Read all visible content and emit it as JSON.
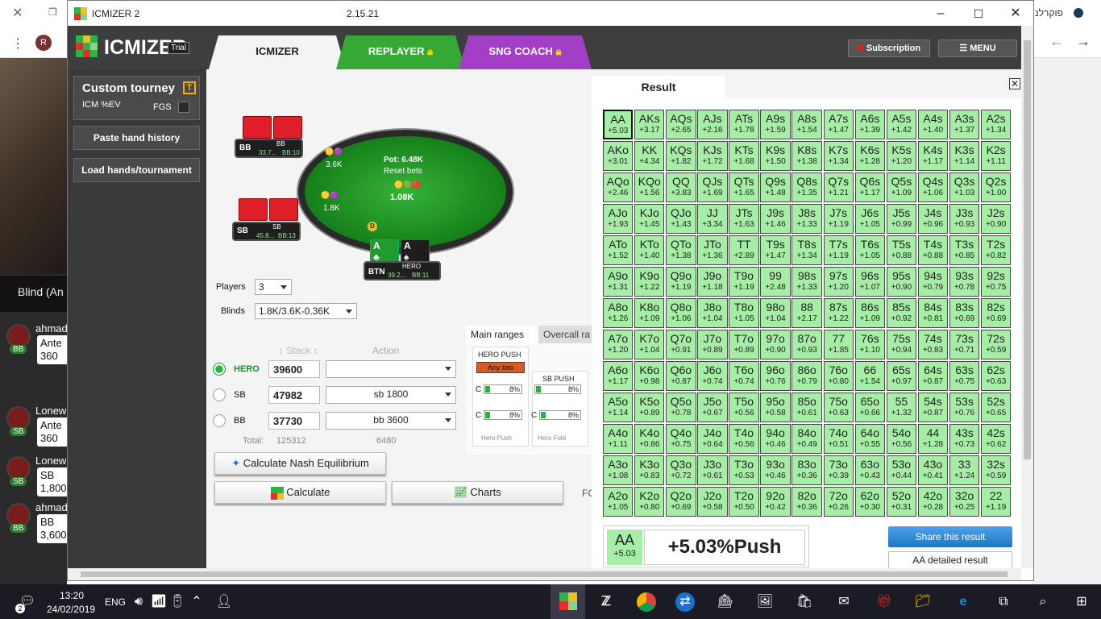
{
  "app": {
    "title": "ICMIZER 2",
    "version": "2.15.21",
    "logo_text": "ICMIZER",
    "trial_badge": "Trial"
  },
  "background": {
    "hebrew_text": "פוקרלנ",
    "blind_label": "Blind (An",
    "seats": [
      {
        "name": "ahmad",
        "pos": "BB",
        "line1": "Ante",
        "line2": "360"
      },
      {
        "name": "Lonew",
        "pos": "SB",
        "line1": "Ante",
        "line2": "360"
      },
      {
        "name": "Lonew",
        "pos": "SB",
        "line1": "SB",
        "line2": "1,800"
      },
      {
        "name": "ahmad",
        "pos": "BB",
        "line1": "BB",
        "line2": "3,600"
      }
    ]
  },
  "header": {
    "tabs": [
      {
        "label": "ICMIZER"
      },
      {
        "label": "REPLAYER"
      },
      {
        "label": "SNG COACH"
      }
    ],
    "subscription_label": "Subscription",
    "menu_label": "MENU"
  },
  "sidebar": {
    "custom_tourney": "Custom tourney",
    "badge": "T",
    "icm_label": "ICM %EV",
    "fgs_label": "FGS",
    "paste_label": "Paste hand history",
    "load_label": "Load hands/tournament"
  },
  "table": {
    "pot_label": "Pot: 6.48K",
    "reset_label": "Reset bets",
    "center_bet": "1.08K",
    "bb_bet": "3.6K",
    "sb_bet": "1.8K",
    "dealer": "D",
    "bb_seat": {
      "pos": "BB",
      "name": "BB",
      "stack": "33.7...",
      "bbs": "BB:10"
    },
    "sb_seat": {
      "pos": "SB",
      "name": "SB",
      "stack": "45.8...",
      "bbs": "BB:13"
    },
    "hero_seat": {
      "pos": "BTN",
      "name": "HERO",
      "stack": "39.2...",
      "bbs": "BB:11"
    },
    "hero_cards": [
      {
        "rank": "A",
        "suit": "♣"
      },
      {
        "rank": "A",
        "suit": "♠"
      }
    ]
  },
  "settings": {
    "players_label": "Players",
    "players_value": "3",
    "blinds_label": "Blinds",
    "blinds_value": "1.8K/3.6K-0.36K",
    "stack_header": "Stack",
    "action_header": "Action",
    "rows": [
      {
        "name": "HERO",
        "stack": "39600",
        "action": ""
      },
      {
        "name": "SB",
        "stack": "47982",
        "action": "sb 1800"
      },
      {
        "name": "BB",
        "stack": "37730",
        "action": "bb 3600"
      }
    ],
    "total_label": "Total:",
    "total_stack": "125312",
    "total_action": "6480",
    "nash_label": "Calculate Nash Equilibrium",
    "calculate_label": "Calculate",
    "charts_label": "Charts",
    "fc_label": "FC"
  },
  "ranges": {
    "tab_main": "Main ranges",
    "tab_overcall": "Overcall ra",
    "hero_push_label": "HERO PUSH",
    "any_two": "Any two",
    "sb_push_label": "SB PUSH",
    "c_label": "C",
    "pct1": "8%",
    "pct2": "8%",
    "pct3": "8%",
    "pct4": "8%",
    "hero_push_footer": "Hero Push",
    "hero_fold_footer": "Hero Fold"
  },
  "result": {
    "title": "Result",
    "grid": [
      [
        [
          "AA",
          "+5.03"
        ],
        [
          "AKs",
          "+3.17"
        ],
        [
          "AQs",
          "+2.65"
        ],
        [
          "AJs",
          "+2.16"
        ],
        [
          "ATs",
          "+1.78"
        ],
        [
          "A9s",
          "+1.59"
        ],
        [
          "A8s",
          "+1.54"
        ],
        [
          "A7s",
          "+1.47"
        ],
        [
          "A6s",
          "+1.39"
        ],
        [
          "A5s",
          "+1.42"
        ],
        [
          "A4s",
          "+1.40"
        ],
        [
          "A3s",
          "+1.37"
        ],
        [
          "A2s",
          "+1.34"
        ]
      ],
      [
        [
          "AKo",
          "+3.01"
        ],
        [
          "KK",
          "+4.34"
        ],
        [
          "KQs",
          "+1.82"
        ],
        [
          "KJs",
          "+1.72"
        ],
        [
          "KTs",
          "+1.68"
        ],
        [
          "K9s",
          "+1.50"
        ],
        [
          "K8s",
          "+1.38"
        ],
        [
          "K7s",
          "+1.34"
        ],
        [
          "K6s",
          "+1.28"
        ],
        [
          "K5s",
          "+1.20"
        ],
        [
          "K4s",
          "+1.17"
        ],
        [
          "K3s",
          "+1.14"
        ],
        [
          "K2s",
          "+1.11"
        ]
      ],
      [
        [
          "AQo",
          "+2.46"
        ],
        [
          "KQo",
          "+1.56"
        ],
        [
          "QQ",
          "+3.83"
        ],
        [
          "QJs",
          "+1.69"
        ],
        [
          "QTs",
          "+1.65"
        ],
        [
          "Q9s",
          "+1.48"
        ],
        [
          "Q8s",
          "+1.35"
        ],
        [
          "Q7s",
          "+1.21"
        ],
        [
          "Q6s",
          "+1.17"
        ],
        [
          "Q5s",
          "+1.09"
        ],
        [
          "Q4s",
          "+1.06"
        ],
        [
          "Q3s",
          "+1.03"
        ],
        [
          "Q2s",
          "+1.00"
        ]
      ],
      [
        [
          "AJo",
          "+1.93"
        ],
        [
          "KJo",
          "+1.45"
        ],
        [
          "QJo",
          "+1.43"
        ],
        [
          "JJ",
          "+3.34"
        ],
        [
          "JTs",
          "+1.63"
        ],
        [
          "J9s",
          "+1.46"
        ],
        [
          "J8s",
          "+1.33"
        ],
        [
          "J7s",
          "+1.19"
        ],
        [
          "J6s",
          "+1.05"
        ],
        [
          "J5s",
          "+0.99"
        ],
        [
          "J4s",
          "+0.96"
        ],
        [
          "J3s",
          "+0.93"
        ],
        [
          "J2s",
          "+0.90"
        ]
      ],
      [
        [
          "ATo",
          "+1.52"
        ],
        [
          "KTo",
          "+1.40"
        ],
        [
          "QTo",
          "+1.38"
        ],
        [
          "JTo",
          "+1.36"
        ],
        [
          "TT",
          "+2.89"
        ],
        [
          "T9s",
          "+1.47"
        ],
        [
          "T8s",
          "+1.34"
        ],
        [
          "T7s",
          "+1.19"
        ],
        [
          "T6s",
          "+1.05"
        ],
        [
          "T5s",
          "+0.88"
        ],
        [
          "T4s",
          "+0.88"
        ],
        [
          "T3s",
          "+0.85"
        ],
        [
          "T2s",
          "+0.82"
        ]
      ],
      [
        [
          "A9o",
          "+1.31"
        ],
        [
          "K9o",
          "+1.22"
        ],
        [
          "Q9o",
          "+1.19"
        ],
        [
          "J9o",
          "+1.18"
        ],
        [
          "T9o",
          "+1.19"
        ],
        [
          "99",
          "+2.48"
        ],
        [
          "98s",
          "+1.33"
        ],
        [
          "97s",
          "+1.20"
        ],
        [
          "96s",
          "+1.07"
        ],
        [
          "95s",
          "+0.90"
        ],
        [
          "94s",
          "+0.79"
        ],
        [
          "93s",
          "+0.78"
        ],
        [
          "92s",
          "+0.75"
        ]
      ],
      [
        [
          "A8o",
          "+1.26"
        ],
        [
          "K8o",
          "+1.09"
        ],
        [
          "Q8o",
          "+1.06"
        ],
        [
          "J8o",
          "+1.04"
        ],
        [
          "T8o",
          "+1.05"
        ],
        [
          "98o",
          "+1.04"
        ],
        [
          "88",
          "+2.17"
        ],
        [
          "87s",
          "+1.22"
        ],
        [
          "86s",
          "+1.09"
        ],
        [
          "85s",
          "+0.92"
        ],
        [
          "84s",
          "+0.81"
        ],
        [
          "83s",
          "+0.69"
        ],
        [
          "82s",
          "+0.69"
        ]
      ],
      [
        [
          "A7o",
          "+1.20"
        ],
        [
          "K7o",
          "+1.04"
        ],
        [
          "Q7o",
          "+0.91"
        ],
        [
          "J7o",
          "+0.89"
        ],
        [
          "T7o",
          "+0.89"
        ],
        [
          "97o",
          "+0.90"
        ],
        [
          "87o",
          "+0.93"
        ],
        [
          "77",
          "+1.85"
        ],
        [
          "76s",
          "+1.10"
        ],
        [
          "75s",
          "+0.94"
        ],
        [
          "74s",
          "+0.83"
        ],
        [
          "73s",
          "+0.71"
        ],
        [
          "72s",
          "+0.59"
        ]
      ],
      [
        [
          "A6o",
          "+1.17"
        ],
        [
          "K6o",
          "+0.98"
        ],
        [
          "Q6o",
          "+0.87"
        ],
        [
          "J6o",
          "+0.74"
        ],
        [
          "T6o",
          "+0.74"
        ],
        [
          "96o",
          "+0.76"
        ],
        [
          "86o",
          "+0.79"
        ],
        [
          "76o",
          "+0.80"
        ],
        [
          "66",
          "+1.54"
        ],
        [
          "65s",
          "+0.97"
        ],
        [
          "64s",
          "+0.87"
        ],
        [
          "63s",
          "+0.75"
        ],
        [
          "62s",
          "+0.63"
        ]
      ],
      [
        [
          "A5o",
          "+1.14"
        ],
        [
          "K5o",
          "+0.89"
        ],
        [
          "Q5o",
          "+0.78"
        ],
        [
          "J5o",
          "+0.67"
        ],
        [
          "T5o",
          "+0.56"
        ],
        [
          "95o",
          "+0.58"
        ],
        [
          "85o",
          "+0.61"
        ],
        [
          "75o",
          "+0.63"
        ],
        [
          "65o",
          "+0.66"
        ],
        [
          "55",
          "+1.32"
        ],
        [
          "54s",
          "+0.87"
        ],
        [
          "53s",
          "+0.76"
        ],
        [
          "52s",
          "+0.65"
        ]
      ],
      [
        [
          "A4o",
          "+1.11"
        ],
        [
          "K4o",
          "+0.86"
        ],
        [
          "Q4o",
          "+0.75"
        ],
        [
          "J4o",
          "+0.64"
        ],
        [
          "T4o",
          "+0.56"
        ],
        [
          "94o",
          "+0.46"
        ],
        [
          "84o",
          "+0.49"
        ],
        [
          "74o",
          "+0.51"
        ],
        [
          "64o",
          "+0.55"
        ],
        [
          "54o",
          "+0.56"
        ],
        [
          "44",
          "+1.28"
        ],
        [
          "43s",
          "+0.73"
        ],
        [
          "42s",
          "+0.62"
        ]
      ],
      [
        [
          "A3o",
          "+1.08"
        ],
        [
          "K3o",
          "+0.83"
        ],
        [
          "Q3o",
          "+0.72"
        ],
        [
          "J3o",
          "+0.61"
        ],
        [
          "T3o",
          "+0.53"
        ],
        [
          "93o",
          "+0.46"
        ],
        [
          "83o",
          "+0.36"
        ],
        [
          "73o",
          "+0.39"
        ],
        [
          "63o",
          "+0.43"
        ],
        [
          "53o",
          "+0.44"
        ],
        [
          "43o",
          "+0.41"
        ],
        [
          "33",
          "+1.24"
        ],
        [
          "32s",
          "+0.59"
        ]
      ],
      [
        [
          "A2o",
          "+1.05"
        ],
        [
          "K2o",
          "+0.80"
        ],
        [
          "Q2o",
          "+0.69"
        ],
        [
          "J2o",
          "+0.58"
        ],
        [
          "T2o",
          "+0.50"
        ],
        [
          "92o",
          "+0.42"
        ],
        [
          "82o",
          "+0.36"
        ],
        [
          "72o",
          "+0.26"
        ],
        [
          "62o",
          "+0.30"
        ],
        [
          "52o",
          "+0.31"
        ],
        [
          "42o",
          "+0.28"
        ],
        [
          "32o",
          "+0.25"
        ],
        [
          "22",
          "+1.19"
        ]
      ]
    ],
    "selected_hand": "AA",
    "selected_ev": "+5.03",
    "selected_summary": "+5.03%Push",
    "share_label": "Share this result",
    "detailed_label": "AA detailed result"
  },
  "taskbar": {
    "time": "13:20",
    "date": "24/02/2019",
    "lang": "ENG",
    "notif_count": "2"
  },
  "colors": {
    "push_cell": "#a6eea6",
    "accent_green": "#35a836",
    "coach_purple": "#a23fc6",
    "share_blue": "#1c77c3"
  }
}
